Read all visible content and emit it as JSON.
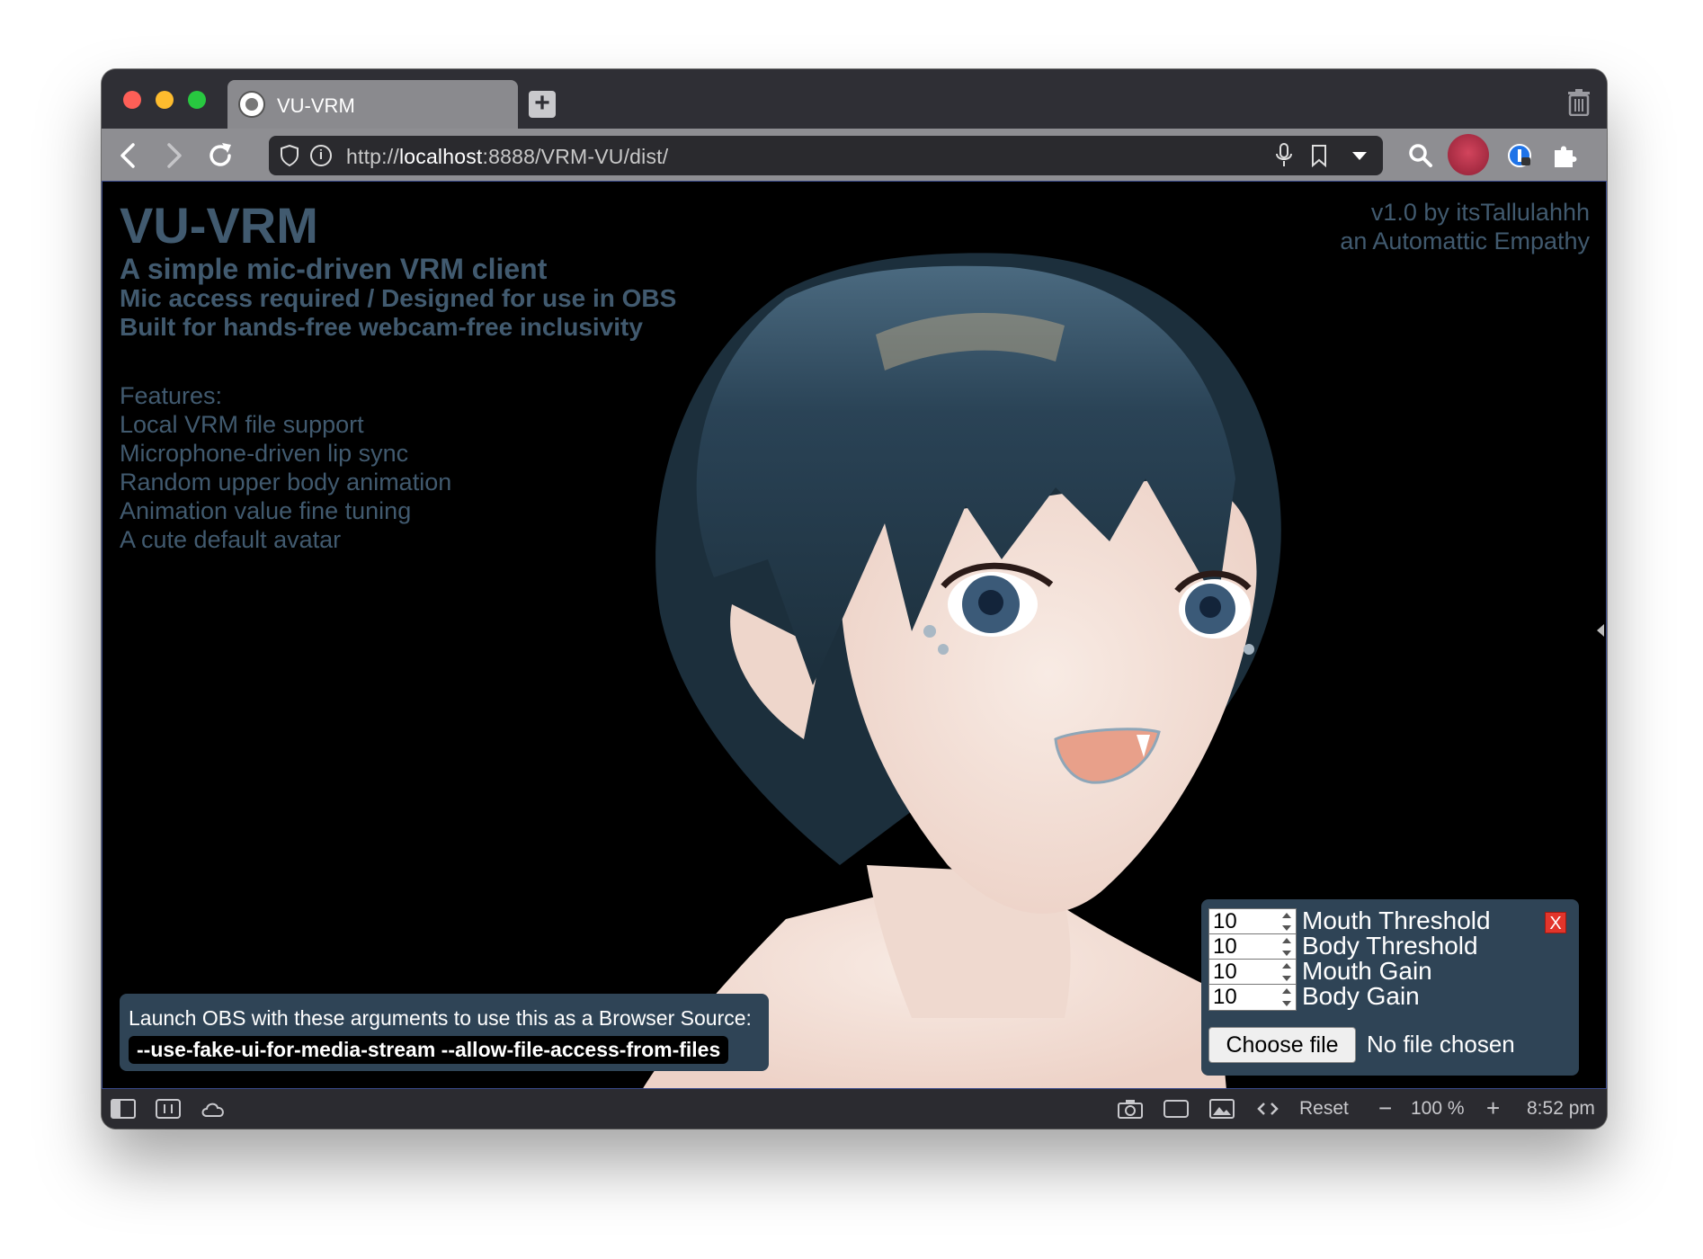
{
  "browser": {
    "tab_title": "VU-VRM",
    "url_prefix": "http://",
    "url_host": "localhost",
    "url_rest": ":8888/VRM-VU/dist/"
  },
  "page": {
    "title": "VU-VRM",
    "subtitle": "A simple mic-driven VRM client",
    "line2": "Mic access required / Designed for use in OBS",
    "line3": "Built for hands-free webcam-free inclusivity",
    "features_heading": "Features:",
    "features": [
      "Local VRM file support",
      "Microphone-driven lip sync",
      "Random upper body animation",
      "Animation value fine tuning",
      "A cute default avatar"
    ],
    "credit_line1": "v1.0 by itsTallulahhh",
    "credit_line2": "an Automattic Empathy"
  },
  "obs": {
    "instruction": "Launch OBS with these arguments to use this as a Browser Source:",
    "args": "--use-fake-ui-for-media-stream --allow-file-access-from-files"
  },
  "controls": {
    "close_label": "X",
    "rows": [
      {
        "value": "10",
        "label": "Mouth Threshold"
      },
      {
        "value": "10",
        "label": "Body Threshold"
      },
      {
        "value": "10",
        "label": "Mouth Gain"
      },
      {
        "value": "10",
        "label": "Body Gain"
      }
    ],
    "file_button": "Choose file",
    "file_status": "No file chosen"
  },
  "statusbar": {
    "reset": "Reset",
    "zoom": "100 %",
    "time": "8:52 pm"
  },
  "colors": {
    "text_muted": "#415a6f",
    "panel": "#2f4456",
    "hair": "#24394a",
    "skin": "#f3e2da"
  }
}
